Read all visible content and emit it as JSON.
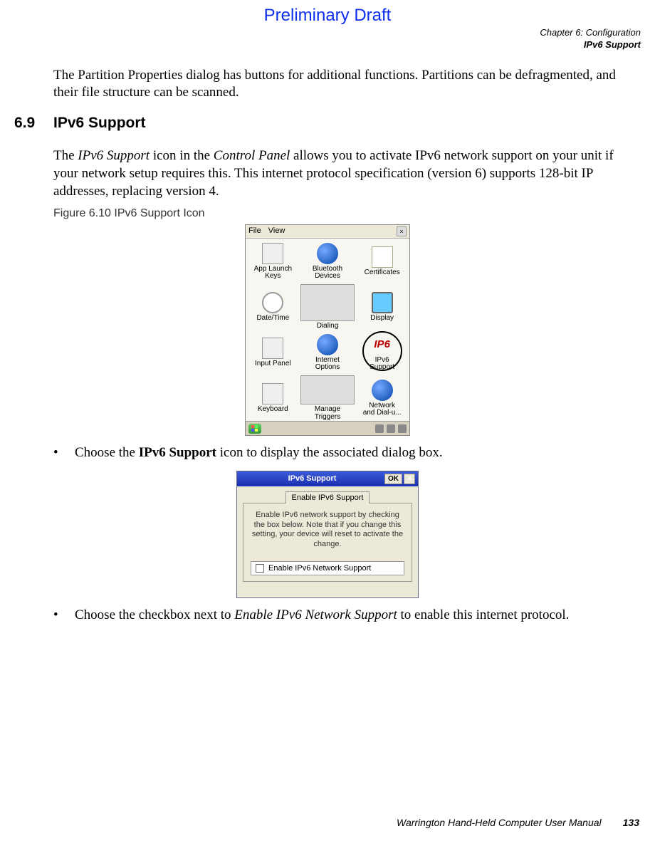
{
  "preliminary": "Preliminary Draft",
  "header": {
    "chapter": "Chapter 6: Configuration",
    "section": "IPv6 Support"
  },
  "para1": "The Partition Properties dialog has buttons for additional functions. Partitions can be defrag­mented, and their file structure can be scanned.",
  "sec": {
    "num": "6.9",
    "title": "IPv6 Support"
  },
  "para2_a": "The ",
  "para2_b": "IPv6 Support",
  "para2_c": " icon in the ",
  "para2_d": "Control Panel",
  "para2_e": " allows you to activate IPv6 network support on your unit if your network setup requires this. This internet protocol specification (version 6) supports 128-bit IP addresses, replacing version 4.",
  "figure_label": "Figure 6.10 IPv6 Support Icon",
  "cpanel": {
    "menu_file": "File",
    "menu_view": "View",
    "close_x": "×",
    "items": {
      "app_launch_keys": "App Launch\nKeys",
      "bluetooth": "Bluetooth\nDevices",
      "certificates": "Certificates",
      "date_time": "Date/Time",
      "dialing": "Dialing",
      "display": "Display",
      "input_panel": "Input Panel",
      "internet_options": "Internet\nOptions",
      "ipv6_support": "IPv6\nSupport",
      "ipv6_icon_text": "IP6",
      "keyboard": "Keyboard",
      "manage_triggers": "Manage\nTriggers",
      "network": "Network\nand Dial-u..."
    }
  },
  "bullet1_a": "Choose the ",
  "bullet1_b": "IPv6 Support",
  "bullet1_c": " icon to display the associated dialog box.",
  "dialog": {
    "title": "IPv6 Support",
    "ok": "OK",
    "x": "×",
    "tab": "Enable IPv6 Support",
    "desc": "Enable IPv6 network support by checking the box below.  Note that if you change this setting, your device will reset to activate the change.",
    "check_label": "Enable IPv6 Network Support"
  },
  "bullet2_a": "Choose the checkbox next to ",
  "bullet2_b": "Enable IPv6 Network Support",
  "bullet2_c": " to enable this internet protocol.",
  "footer": {
    "manual": "Warrington Hand-Held Computer User Manual",
    "page": "133"
  }
}
